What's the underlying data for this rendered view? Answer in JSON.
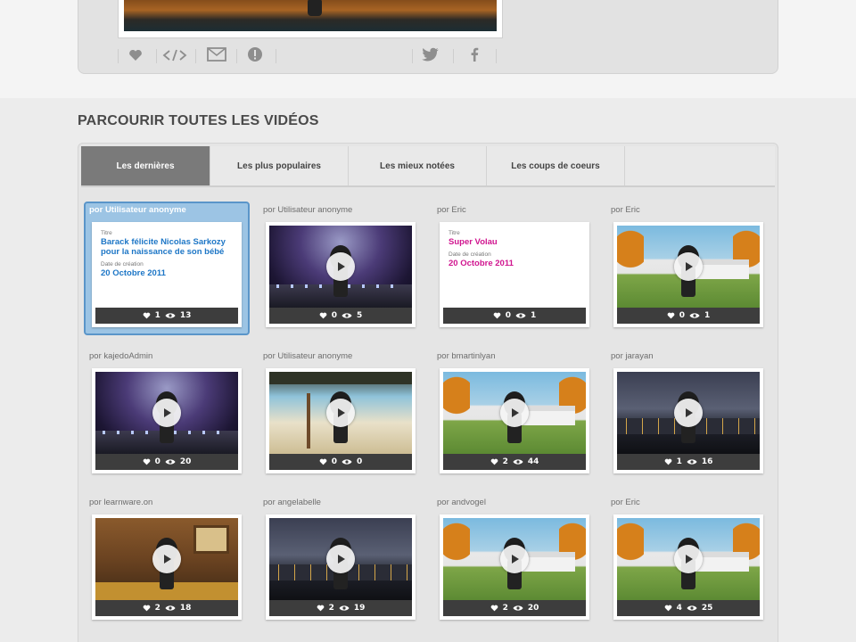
{
  "share_bar": {
    "buttons": [
      {
        "name": "like",
        "icon": "heart-icon"
      },
      {
        "name": "embed",
        "icon": "code-icon"
      },
      {
        "name": "email",
        "icon": "envelope-icon"
      },
      {
        "name": "report",
        "icon": "alert-icon"
      },
      {
        "name": "twitter",
        "icon": "twitter-icon"
      },
      {
        "name": "facebook",
        "icon": "facebook-icon"
      }
    ]
  },
  "section": {
    "title": "PARCOURIR TOUTES LES VIDÉOS"
  },
  "tabs": [
    {
      "label": "Les dernières",
      "active": true
    },
    {
      "label": "Les plus populaires",
      "active": false
    },
    {
      "label": "Les mieux notées",
      "active": false
    },
    {
      "label": "Les coups de coeurs",
      "active": false
    }
  ],
  "videos": [
    {
      "author": "por Utilisateur anonyme",
      "scene": "card-blue",
      "likes": "1",
      "views": "13",
      "selected": true,
      "card": {
        "title_label": "Titre",
        "title": "Barack félicite Nicolas Sarkozy pour la naissance de son bébé",
        "date_label": "Date de création",
        "date": "20 Octobre 2011"
      }
    },
    {
      "author": "por Utilisateur anonyme",
      "scene": "stage",
      "likes": "0",
      "views": "5"
    },
    {
      "author": "por Eric",
      "scene": "card-pink",
      "likes": "0",
      "views": "1",
      "card": {
        "title_label": "Titre",
        "title": "Super Volau",
        "date_label": "Date de création",
        "date": "20 Octobre 2011"
      }
    },
    {
      "author": "por Eric",
      "scene": "whitehouse",
      "likes": "0",
      "views": "1"
    },
    {
      "author": "por kajedoAdmin",
      "scene": "stage",
      "likes": "0",
      "views": "20"
    },
    {
      "author": "por Utilisateur anonyme",
      "scene": "beach",
      "likes": "0",
      "views": "0"
    },
    {
      "author": "por bmartinlyan",
      "scene": "whitehouse",
      "likes": "2",
      "views": "44"
    },
    {
      "author": "por jarayan",
      "scene": "city",
      "likes": "1",
      "views": "16"
    },
    {
      "author": "por learnware.on",
      "scene": "room",
      "likes": "2",
      "views": "18"
    },
    {
      "author": "por angelabelle",
      "scene": "city",
      "likes": "2",
      "views": "19"
    },
    {
      "author": "por andvogel",
      "scene": "whitehouse",
      "likes": "2",
      "views": "20"
    },
    {
      "author": "por Eric",
      "scene": "whitehouse",
      "likes": "4",
      "views": "25"
    }
  ]
}
